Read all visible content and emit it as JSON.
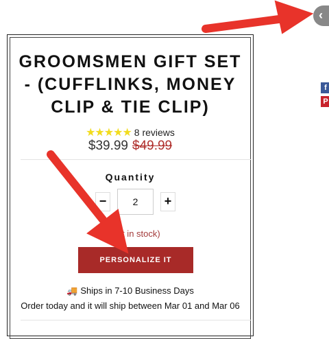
{
  "product": {
    "title": "GROOMSMEN GIFT SET - (CUFFLINKS, MONEY CLIP & TIE CLIP)",
    "rating_stars": "★★★★★",
    "reviews_label": "8 reviews",
    "price_current": "$39.99",
    "price_original": "$49.99"
  },
  "quantity": {
    "label": "Quantity",
    "minus_label": "−",
    "value": "2",
    "plus_label": "+"
  },
  "stock_text": "36 left in stock)",
  "personalize_label": "PERSONALIZE IT",
  "shipping": {
    "truck_icon": "🚚",
    "line": "Ships in 7-10 Business Days",
    "dates": "Order today and it will ship between Mar 01 and Mar 06"
  },
  "side": {
    "back_icon": "‹",
    "facebook_icon": "f",
    "pinterest_icon": "P"
  },
  "colors": {
    "accent": "#a82a28",
    "arrow": "#e8332a",
    "star": "#f2dc1e",
    "sale_price": "#b0302d"
  }
}
